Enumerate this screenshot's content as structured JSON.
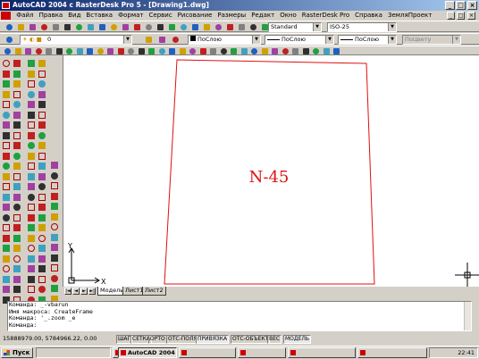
{
  "window": {
    "title": "AutoCAD 2004 с RasterDesk Pro 5 - [Drawing1.dwg]",
    "min_glyph": "_",
    "max_glyph": "□",
    "close_glyph": "×"
  },
  "menu": [
    "Файл",
    "Правка",
    "Вид",
    "Вставка",
    "Формат",
    "Сервис",
    "Рисование",
    "Размеры",
    "Редакт",
    "Окно",
    "RasterDesk Pro",
    "Справка",
    "ЗемляПроект"
  ],
  "toolbar": {
    "layer_value": "0",
    "textstyle_value": "Standard",
    "dimstyle_value": "ISO-25",
    "color_value": "ПоСлою",
    "linetype_value": "ПоСлою",
    "lineweight_value": "ПоСлою",
    "plotstyle_value": "ПоЦвету",
    "dropdown_glyph": "▼"
  },
  "drawing": {
    "label": "N-45",
    "line_color": "#e01010",
    "ucs_x": "X",
    "ucs_y": "Y"
  },
  "layout_tabs": {
    "nav": [
      "|◄",
      "◄",
      "►",
      "►|"
    ],
    "tabs": [
      "Модель",
      "Лист1",
      "Лист2"
    ]
  },
  "command_lines": [
    "Команда: _-vbarun",
    "Имя макроса: CreateFrame",
    "Команда: '_.zoom _e",
    "Команда:"
  ],
  "status": {
    "coords": "15888979.00, 5784966.22, 0.00",
    "toggles": [
      {
        "label": "ШАГ",
        "on": false
      },
      {
        "label": "СЕТКА",
        "on": false
      },
      {
        "label": "ОРТО",
        "on": false
      },
      {
        "label": "ОТС-ПОЛЯР",
        "on": false
      },
      {
        "label": "ПРИВЯЗКА",
        "on": true
      },
      {
        "label": "ОТС-ОБЪЕКТ",
        "on": false
      },
      {
        "label": "ВЕС",
        "on": false
      },
      {
        "label": "МОДЕЛЬ",
        "on": true
      }
    ]
  },
  "taskbar": {
    "start": "Пуск",
    "tasks": [
      "",
      "AutoCAD 2004 с Ras...",
      "",
      "",
      "",
      ""
    ],
    "clock": "22:41"
  }
}
